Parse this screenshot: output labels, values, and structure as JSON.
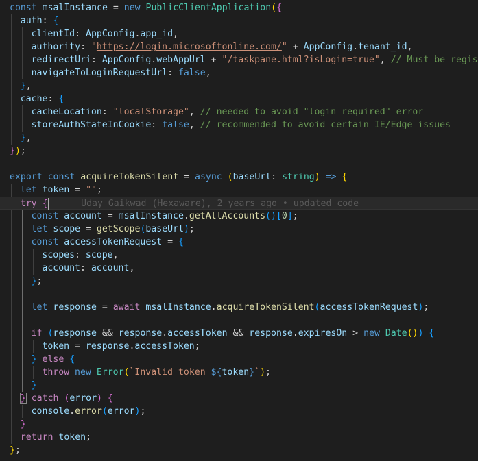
{
  "editor": {
    "language": "typescript",
    "theme": "Dark+",
    "background": "#1e1e1e",
    "lines": [
      {
        "indent": 0,
        "tokens": [
          [
            "kw",
            "const"
          ],
          [
            "txt",
            " "
          ],
          [
            "var",
            "msalInstance"
          ],
          [
            "txt",
            " = "
          ],
          [
            "kw",
            "new"
          ],
          [
            "txt",
            " "
          ],
          [
            "cls",
            "PublicClientApplication"
          ],
          [
            "b1",
            "("
          ],
          [
            "b2",
            "{"
          ]
        ]
      },
      {
        "indent": 1,
        "tokens": [
          [
            "var",
            "auth"
          ],
          [
            "txt",
            ": "
          ],
          [
            "b3",
            "{"
          ]
        ]
      },
      {
        "indent": 2,
        "tokens": [
          [
            "var",
            "clientId"
          ],
          [
            "txt",
            ": "
          ],
          [
            "var",
            "AppConfig"
          ],
          [
            "txt",
            "."
          ],
          [
            "var",
            "app_id"
          ],
          [
            "txt",
            ","
          ]
        ]
      },
      {
        "indent": 2,
        "tokens": [
          [
            "var",
            "authority"
          ],
          [
            "txt",
            ": "
          ],
          [
            "str",
            "\""
          ],
          [
            "url",
            "https://login.microsoftonline.com/"
          ],
          [
            "str",
            "\""
          ],
          [
            "txt",
            " + "
          ],
          [
            "var",
            "AppConfig"
          ],
          [
            "txt",
            "."
          ],
          [
            "var",
            "tenant_id"
          ],
          [
            "txt",
            ","
          ]
        ]
      },
      {
        "indent": 2,
        "tokens": [
          [
            "var",
            "redirectUri"
          ],
          [
            "txt",
            ": "
          ],
          [
            "var",
            "AppConfig"
          ],
          [
            "txt",
            "."
          ],
          [
            "var",
            "webAppUrl"
          ],
          [
            "txt",
            " + "
          ],
          [
            "str",
            "\"/taskpane.html?isLogin=true\""
          ],
          [
            "txt",
            ", "
          ],
          [
            "cmt",
            "// Must be registered as a redirect URI"
          ]
        ]
      },
      {
        "indent": 2,
        "tokens": [
          [
            "var",
            "navigateToLoginRequestUrl"
          ],
          [
            "txt",
            ": "
          ],
          [
            "kw",
            "false"
          ],
          [
            "txt",
            ","
          ]
        ]
      },
      {
        "indent": 1,
        "tokens": [
          [
            "b3",
            "}"
          ],
          [
            "txt",
            ","
          ]
        ]
      },
      {
        "indent": 1,
        "tokens": [
          [
            "var",
            "cache"
          ],
          [
            "txt",
            ": "
          ],
          [
            "b3",
            "{"
          ]
        ]
      },
      {
        "indent": 2,
        "tokens": [
          [
            "var",
            "cacheLocation"
          ],
          [
            "txt",
            ": "
          ],
          [
            "str",
            "\"localStorage\""
          ],
          [
            "txt",
            ", "
          ],
          [
            "cmt",
            "// needed to avoid \"login required\" error"
          ]
        ]
      },
      {
        "indent": 2,
        "tokens": [
          [
            "var",
            "storeAuthStateInCookie"
          ],
          [
            "txt",
            ": "
          ],
          [
            "kw",
            "false"
          ],
          [
            "txt",
            ", "
          ],
          [
            "cmt",
            "// recommended to avoid certain IE/Edge issues"
          ]
        ]
      },
      {
        "indent": 1,
        "tokens": [
          [
            "b3",
            "}"
          ],
          [
            "txt",
            ","
          ]
        ]
      },
      {
        "indent": 0,
        "tokens": [
          [
            "b2",
            "}"
          ],
          [
            "b1",
            ")"
          ],
          [
            "txt",
            ";"
          ]
        ]
      },
      {
        "indent": 0,
        "tokens": []
      },
      {
        "indent": 0,
        "tokens": [
          [
            "kw",
            "export"
          ],
          [
            "txt",
            " "
          ],
          [
            "kw",
            "const"
          ],
          [
            "txt",
            " "
          ],
          [
            "fn",
            "acquireTokenSilent"
          ],
          [
            "txt",
            " = "
          ],
          [
            "kw",
            "async"
          ],
          [
            "txt",
            " "
          ],
          [
            "b1",
            "("
          ],
          [
            "var",
            "baseUrl"
          ],
          [
            "txt",
            ": "
          ],
          [
            "cls",
            "string"
          ],
          [
            "b1",
            ")"
          ],
          [
            "txt",
            " "
          ],
          [
            "kw",
            "=>"
          ],
          [
            "txt",
            " "
          ],
          [
            "b1",
            "{"
          ]
        ]
      },
      {
        "indent": 1,
        "tokens": [
          [
            "kw",
            "let"
          ],
          [
            "txt",
            " "
          ],
          [
            "var",
            "token"
          ],
          [
            "txt",
            " = "
          ],
          [
            "str",
            "\"\""
          ],
          [
            "txt",
            ";"
          ]
        ]
      },
      {
        "indent": 1,
        "current": true,
        "tokens": [
          [
            "ctl",
            "try"
          ],
          [
            "txt",
            " "
          ],
          [
            "b2",
            "{"
          ],
          [
            "cursor",
            ""
          ],
          [
            "blame",
            "      Uday Gaikwad (Hexaware), 2 years ago • updated code"
          ]
        ]
      },
      {
        "indent": 2,
        "tokens": [
          [
            "kw",
            "const"
          ],
          [
            "txt",
            " "
          ],
          [
            "var",
            "account"
          ],
          [
            "txt",
            " = "
          ],
          [
            "var",
            "msalInstance"
          ],
          [
            "txt",
            "."
          ],
          [
            "fn",
            "getAllAccounts"
          ],
          [
            "b3",
            "()"
          ],
          [
            "b3",
            "["
          ],
          [
            "num",
            "0"
          ],
          [
            "b3",
            "]"
          ],
          [
            "txt",
            ";"
          ]
        ]
      },
      {
        "indent": 2,
        "tokens": [
          [
            "kw",
            "let"
          ],
          [
            "txt",
            " "
          ],
          [
            "var",
            "scope"
          ],
          [
            "txt",
            " = "
          ],
          [
            "fn",
            "getScope"
          ],
          [
            "b3",
            "("
          ],
          [
            "var",
            "baseUrl"
          ],
          [
            "b3",
            ")"
          ],
          [
            "txt",
            ";"
          ]
        ]
      },
      {
        "indent": 2,
        "tokens": [
          [
            "kw",
            "const"
          ],
          [
            "txt",
            " "
          ],
          [
            "var",
            "accessTokenRequest"
          ],
          [
            "txt",
            " = "
          ],
          [
            "b3",
            "{"
          ]
        ]
      },
      {
        "indent": 3,
        "tokens": [
          [
            "var",
            "scopes"
          ],
          [
            "txt",
            ": "
          ],
          [
            "var",
            "scope"
          ],
          [
            "txt",
            ","
          ]
        ]
      },
      {
        "indent": 3,
        "tokens": [
          [
            "var",
            "account"
          ],
          [
            "txt",
            ": "
          ],
          [
            "var",
            "account"
          ],
          [
            "txt",
            ","
          ]
        ]
      },
      {
        "indent": 2,
        "tokens": [
          [
            "b3",
            "}"
          ],
          [
            "txt",
            ";"
          ]
        ]
      },
      {
        "indent": 2,
        "tokens": []
      },
      {
        "indent": 2,
        "tokens": [
          [
            "kw",
            "let"
          ],
          [
            "txt",
            " "
          ],
          [
            "var",
            "response"
          ],
          [
            "txt",
            " = "
          ],
          [
            "ctl",
            "await"
          ],
          [
            "txt",
            " "
          ],
          [
            "var",
            "msalInstance"
          ],
          [
            "txt",
            "."
          ],
          [
            "fn",
            "acquireTokenSilent"
          ],
          [
            "b3",
            "("
          ],
          [
            "var",
            "accessTokenRequest"
          ],
          [
            "b3",
            ")"
          ],
          [
            "txt",
            ";"
          ]
        ]
      },
      {
        "indent": 2,
        "tokens": []
      },
      {
        "indent": 2,
        "tokens": [
          [
            "ctl",
            "if"
          ],
          [
            "txt",
            " "
          ],
          [
            "b3",
            "("
          ],
          [
            "var",
            "response"
          ],
          [
            "txt",
            " && "
          ],
          [
            "var",
            "response"
          ],
          [
            "txt",
            "."
          ],
          [
            "var",
            "accessToken"
          ],
          [
            "txt",
            " && "
          ],
          [
            "var",
            "response"
          ],
          [
            "txt",
            "."
          ],
          [
            "var",
            "expiresOn"
          ],
          [
            "txt",
            " > "
          ],
          [
            "kw",
            "new"
          ],
          [
            "txt",
            " "
          ],
          [
            "cls",
            "Date"
          ],
          [
            "b1",
            "()"
          ],
          [
            "b3",
            ")"
          ],
          [
            "txt",
            " "
          ],
          [
            "b3",
            "{"
          ]
        ]
      },
      {
        "indent": 3,
        "tokens": [
          [
            "var",
            "token"
          ],
          [
            "txt",
            " = "
          ],
          [
            "var",
            "response"
          ],
          [
            "txt",
            "."
          ],
          [
            "var",
            "accessToken"
          ],
          [
            "txt",
            ";"
          ]
        ]
      },
      {
        "indent": 2,
        "tokens": [
          [
            "b3",
            "}"
          ],
          [
            "txt",
            " "
          ],
          [
            "ctl",
            "else"
          ],
          [
            "txt",
            " "
          ],
          [
            "b3",
            "{"
          ]
        ]
      },
      {
        "indent": 3,
        "tokens": [
          [
            "ctl",
            "throw"
          ],
          [
            "txt",
            " "
          ],
          [
            "kw",
            "new"
          ],
          [
            "txt",
            " "
          ],
          [
            "cls",
            "Error"
          ],
          [
            "b1",
            "("
          ],
          [
            "str",
            "`Invalid token "
          ],
          [
            "kw",
            "${"
          ],
          [
            "var",
            "token"
          ],
          [
            "kw",
            "}"
          ],
          [
            "str",
            "`"
          ],
          [
            "b1",
            ")"
          ],
          [
            "txt",
            ";"
          ]
        ]
      },
      {
        "indent": 2,
        "tokens": [
          [
            "b3",
            "}"
          ]
        ]
      },
      {
        "indent": 1,
        "tokens": [
          [
            "b2bm",
            "}"
          ],
          [
            "txt",
            " "
          ],
          [
            "ctl",
            "catch"
          ],
          [
            "txt",
            " "
          ],
          [
            "b2",
            "("
          ],
          [
            "var",
            "error"
          ],
          [
            "b2",
            ")"
          ],
          [
            "txt",
            " "
          ],
          [
            "b2",
            "{"
          ]
        ]
      },
      {
        "indent": 2,
        "tokens": [
          [
            "var",
            "console"
          ],
          [
            "txt",
            "."
          ],
          [
            "fn",
            "error"
          ],
          [
            "b3",
            "("
          ],
          [
            "var",
            "error"
          ],
          [
            "b3",
            ")"
          ],
          [
            "txt",
            ";"
          ]
        ]
      },
      {
        "indent": 1,
        "tokens": [
          [
            "b2",
            "}"
          ]
        ]
      },
      {
        "indent": 1,
        "tokens": [
          [
            "ctl",
            "return"
          ],
          [
            "txt",
            " "
          ],
          [
            "var",
            "token"
          ],
          [
            "txt",
            ";"
          ]
        ]
      },
      {
        "indent": 0,
        "tokens": [
          [
            "b1",
            "}"
          ],
          [
            "txt",
            ";"
          ]
        ]
      }
    ]
  }
}
